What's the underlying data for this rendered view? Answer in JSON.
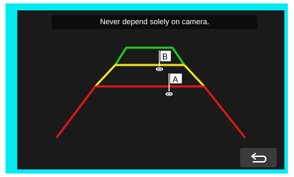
{
  "warning": {
    "text": "Never depend solely on camera."
  },
  "guide_lines": {
    "colors": {
      "far": "#22cc22",
      "mid": "#f2e81e",
      "near": "#e51616"
    }
  },
  "markers": {
    "a": {
      "label": "A"
    },
    "b": {
      "label": "B"
    }
  },
  "back_button": {
    "icon": "back-arrow-icon"
  },
  "colors": {
    "frame": "#00eaf2",
    "screen": "#1a1a1a"
  }
}
